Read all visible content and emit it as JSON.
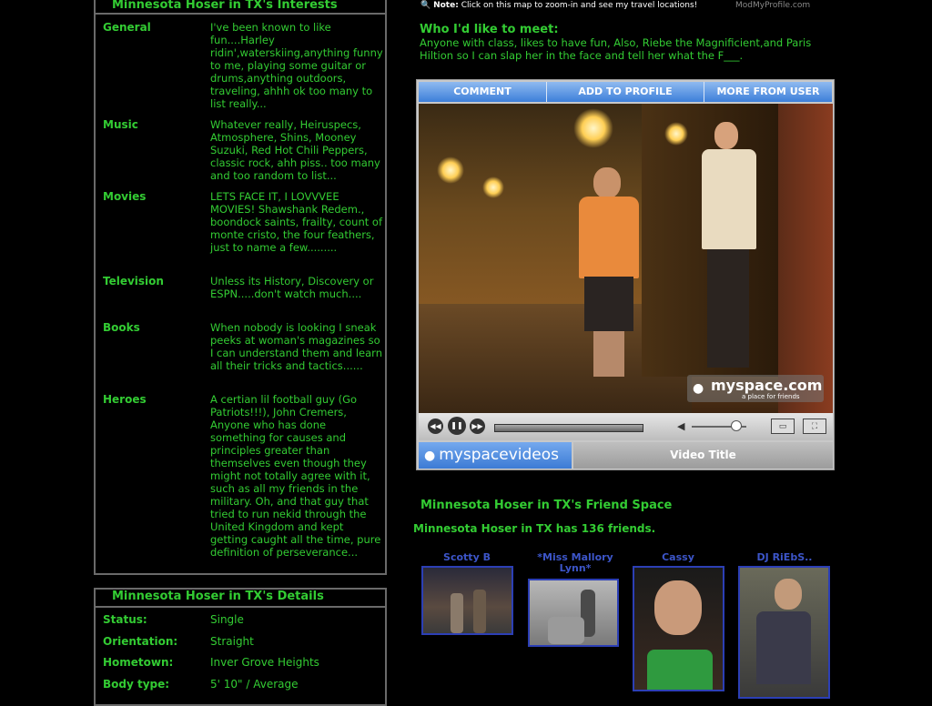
{
  "interests": {
    "title": "Minnesota Hoser in TX's Interests",
    "rows": [
      {
        "label": "General",
        "value": "I've been known to like fun....Harley ridin',waterskiing,anything funny to me, playing some guitar or drums,anything outdoors, traveling, ahhh ok too many to list really..."
      },
      {
        "label": "Music",
        "value": "Whatever really, Heiruspecs, Atmosphere, Shins, Mooney Suzuki, Red Hot Chili Peppers, classic rock, ahh piss.. too many and too random to list..."
      },
      {
        "label": "Movies",
        "value": "LETS FACE IT, I LOVVVEE MOVIES! Shawshank Redem., boondock saints, frailty, count of monte cristo, the four feathers, just to name a few........."
      },
      {
        "label": "Television",
        "value": "Unless its History, Discovery or ESPN.....don't watch much...."
      },
      {
        "label": "Books",
        "value": "When nobody is looking I sneak peeks at woman's magazines so I can understand them and learn all their tricks and tactics......"
      },
      {
        "label": "Heroes",
        "value": "A certian lil football guy (Go Patriots!!!), John Cremers, Anyone who has done something for causes and principles greater than themselves even though they might not totally agree with it, such as all my friends in the military. Oh, and that guy that tried to run nekid through the United Kingdom and kept getting caught all the time, pure definition of perseverance..."
      }
    ]
  },
  "details": {
    "title": "Minnesota Hoser in TX's Details",
    "rows": [
      {
        "label": "Status:",
        "value": "Single"
      },
      {
        "label": "Orientation:",
        "value": "Straight"
      },
      {
        "label": "Hometown:",
        "value": "Inver Grove Heights"
      },
      {
        "label": "Body type:",
        "value": "5' 10\" / Average"
      }
    ]
  },
  "note": {
    "prefix": "Note:",
    "text": "Click on this map to zoom-in and see my travel locations!",
    "credit": "ModMyProfile.com"
  },
  "meet": {
    "title": "Who I'd like to meet:",
    "text": "Anyone with class, likes to have fun, Also, Riebe the Magnificient,and Paris Hiltion so I can slap her in the face and tell her what the F___."
  },
  "player": {
    "tabs": [
      "COMMENT",
      "ADD TO PROFILE",
      "MORE FROM USER"
    ],
    "watermark": "myspace.com",
    "watermark_sub": "a place for friends",
    "logo": "myspacevideos",
    "video_title": "Video Title",
    "progress": 1.0,
    "volume": 0.8
  },
  "friends": {
    "title": "Minnesota Hoser in TX's Friend Space",
    "count_text": "Minnesota Hoser in TX has 136 friends.",
    "items": [
      {
        "name": "Scotty B"
      },
      {
        "name": "*Miss Mallory Lynn*"
      },
      {
        "name": "Cassy"
      },
      {
        "name": "DJ RiEbS.."
      }
    ]
  },
  "colors": {
    "text_green": "#33cc33",
    "friend_blue": "#3c55c8",
    "border_gray": "#6a6a6a"
  }
}
